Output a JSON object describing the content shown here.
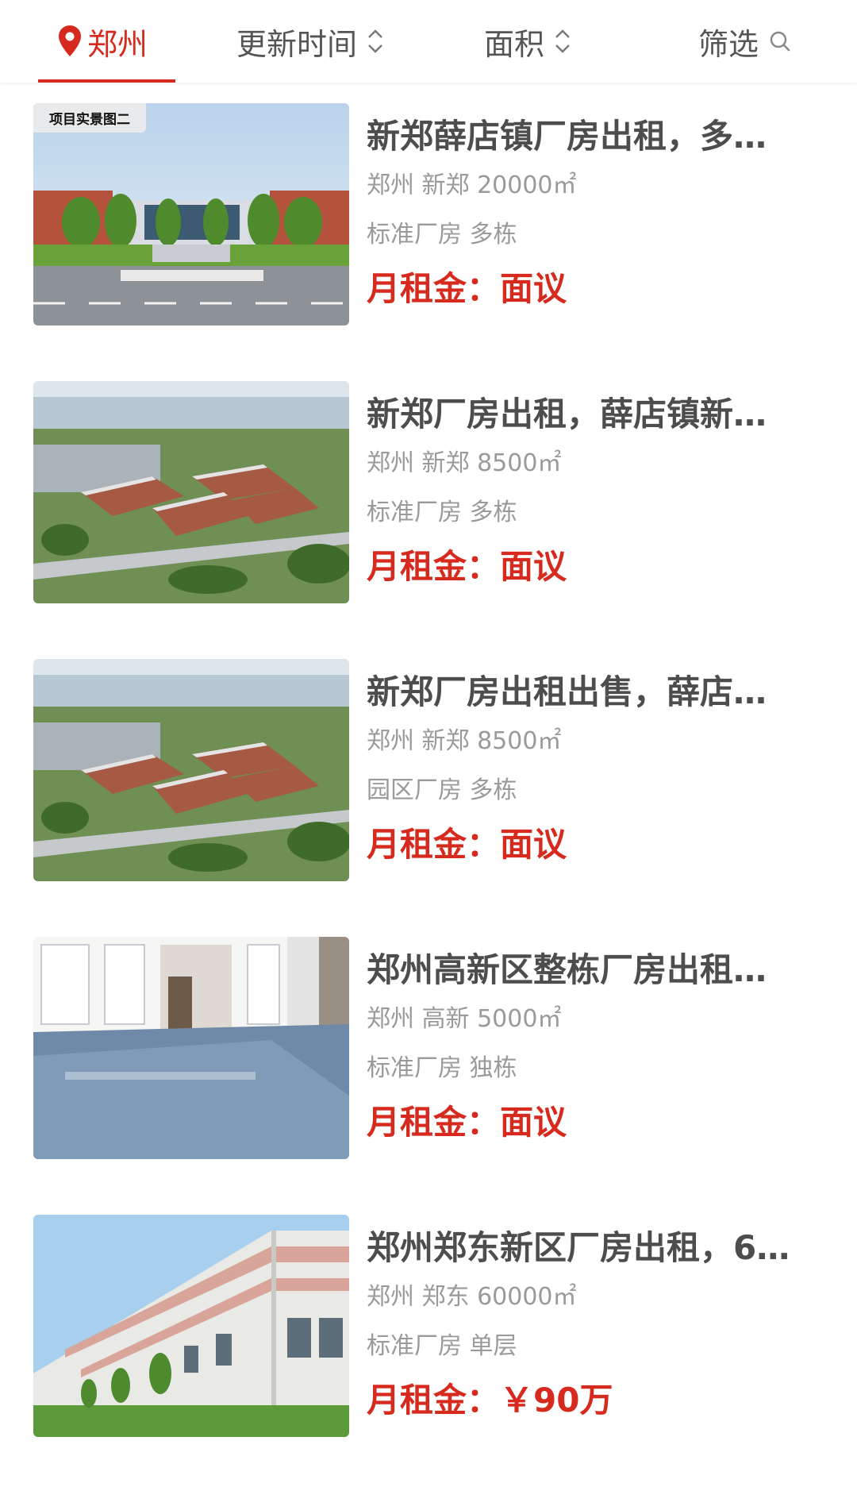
{
  "header": {
    "city_label": "郑州",
    "sort_time_label": "更新时间",
    "sort_area_label": "面积",
    "filter_label": "筛选"
  },
  "colors": {
    "accent": "#d62a1e",
    "title_text": "#4d4d4d",
    "meta_text": "#9a9a9a"
  },
  "listings": [
    {
      "image_tag": "项目实景图二",
      "image_kind": "campus-front-view",
      "title": "新郑薛店镇厂房出租，多…",
      "location_area": "郑州 新郑 20000㎡",
      "type": "标准厂房 多栋",
      "price_label": "月租金：",
      "price_value": "面议"
    },
    {
      "image_tag": "",
      "image_kind": "aerial-industrial-park",
      "title": "新郑厂房出租，薛店镇新…",
      "location_area": "郑州 新郑 8500㎡",
      "type": "标准厂房 多栋",
      "price_label": "月租金：",
      "price_value": "面议"
    },
    {
      "image_tag": "",
      "image_kind": "aerial-industrial-park",
      "title": "新郑厂房出租出售，薛店…",
      "location_area": "郑州 新郑 8500㎡",
      "type": "园区厂房 多栋",
      "price_label": "月租金：",
      "price_value": "面议"
    },
    {
      "image_tag": "",
      "image_kind": "interior-epoxy-floor",
      "title": "郑州高新区整栋厂房出租…",
      "location_area": "郑州 高新 5000㎡",
      "type": "标准厂房 独栋",
      "price_label": "月租金：",
      "price_value": "面议"
    },
    {
      "image_tag": "",
      "image_kind": "steel-warehouse-exterior",
      "title": "郑州郑东新区厂房出租，6…",
      "location_area": "郑州 郑东 60000㎡",
      "type": "标准厂房 单层",
      "price_label": "月租金：",
      "price_value": "￥90万"
    }
  ]
}
